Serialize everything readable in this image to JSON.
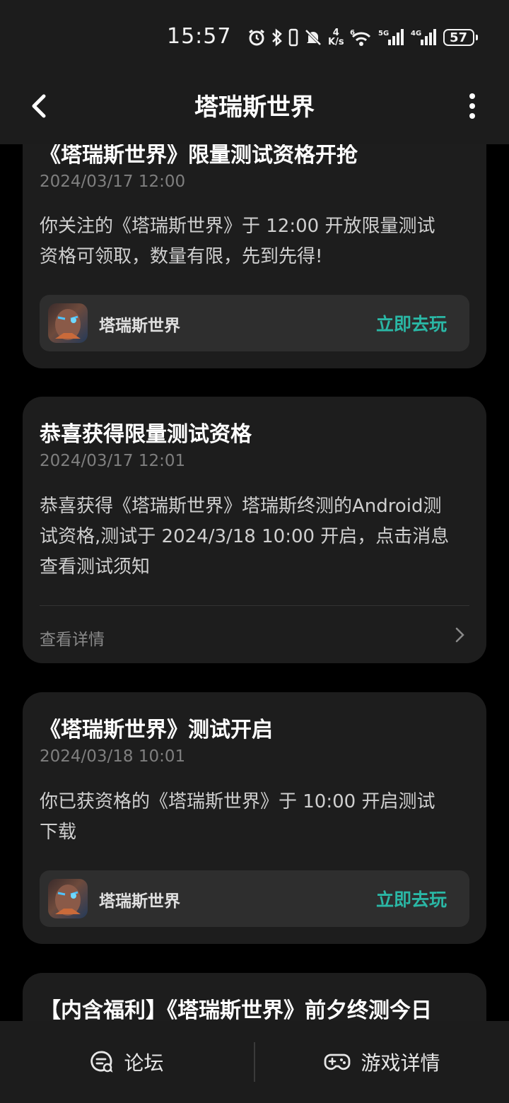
{
  "status_bar": {
    "time": "15:57",
    "network_speed_value": "4",
    "network_speed_unit": "K/s",
    "wifi_label": "6",
    "signal1_label": "5G",
    "signal2_label": "4G",
    "battery": "57"
  },
  "header": {
    "title": "塔瑞斯世界"
  },
  "cards": [
    {
      "title": "《塔瑞斯世界》限量测试资格开抢",
      "date": "2024/03/17 12:00",
      "body_lines": [
        "你关注的《塔瑞斯世界》于 12:00 开放限量测试",
        "资格可领取，数量有限，先到先得!"
      ],
      "game_name": "塔瑞斯世界",
      "play_label": "立即去玩"
    },
    {
      "title": "恭喜获得限量测试资格",
      "date": "2024/03/17 12:01",
      "body_lines": [
        "恭喜获得《塔瑞斯世界》塔瑞斯终测的Android测",
        "试资格,测试于 2024/3/18 10:00 开启，点击消息",
        "查看测试须知"
      ],
      "detail_label": "查看详情"
    },
    {
      "title": "《塔瑞斯世界》测试开启",
      "date": "2024/03/18 10:01",
      "body_lines": [
        "你已获资格的《塔瑞斯世界》于 10:00 开启测试",
        "下载"
      ],
      "game_name": "塔瑞斯世界",
      "play_label": "立即去玩"
    },
    {
      "title": "【内含福利】《塔瑞斯世界》前夕终测今日"
    }
  ],
  "bottom_bar": {
    "forum_label": "论坛",
    "game_detail_label": "游戏详情"
  },
  "colors": {
    "accent": "#2ab7a5",
    "card": "#1d1d1d",
    "bar": "#1c1c1c"
  }
}
